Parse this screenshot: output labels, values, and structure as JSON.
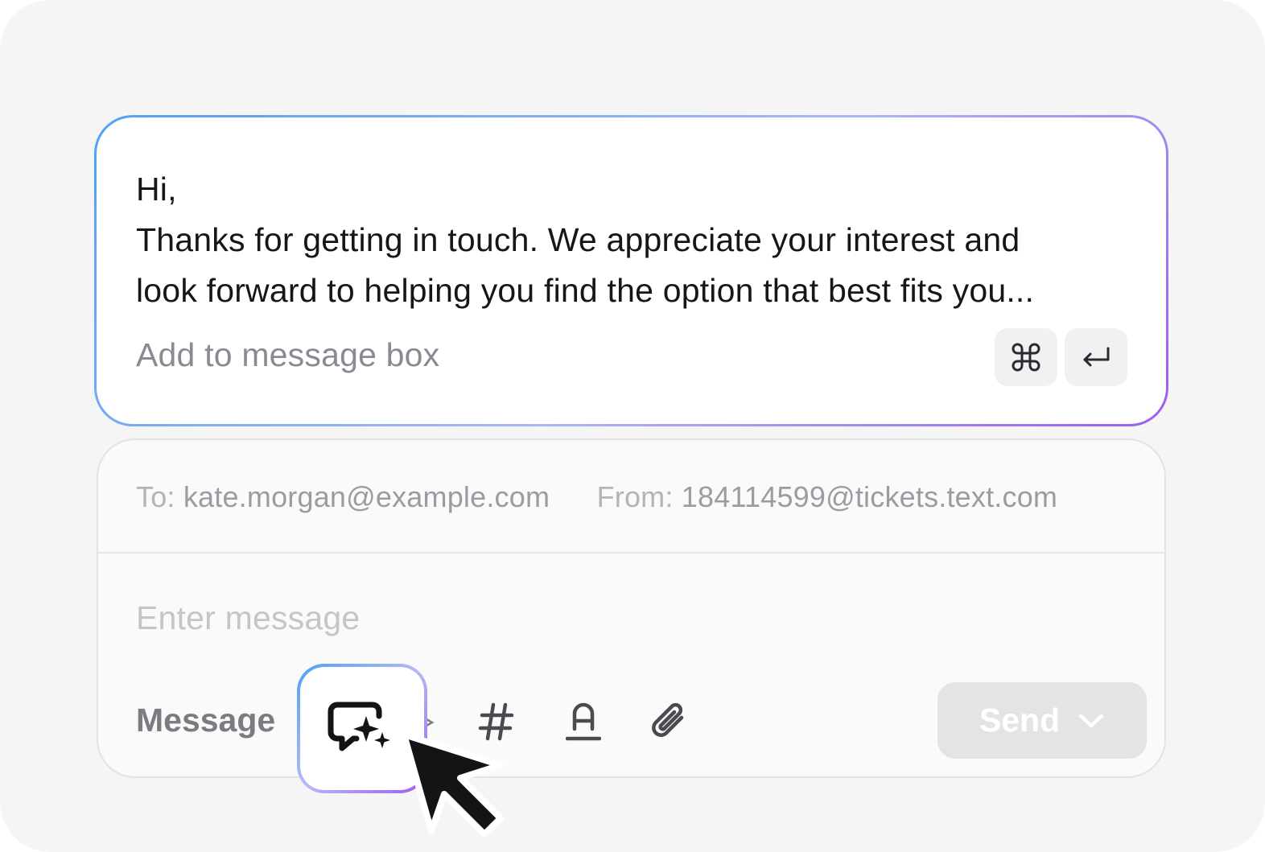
{
  "ai_suggestion": {
    "lines": [
      "Hi,",
      "Thanks for getting in touch. We appreciate your interest and",
      "look forward to helping you find the option that best fits you..."
    ],
    "add_hint": "Add to message box",
    "shortcut_keys": [
      "command-icon",
      "enter-icon"
    ]
  },
  "composer": {
    "to_label": "To:",
    "to_value": "kate.morgan@example.com",
    "from_label": "From:",
    "from_value": "184114599@tickets.text.com",
    "message_placeholder": "Enter message",
    "mode_label": "Message",
    "tools": [
      "ai-compose-icon",
      "hash-icon",
      "text-format-icon",
      "paperclip-icon"
    ],
    "send_label": "Send"
  },
  "colors": {
    "gradient_start": "#4fa2f4",
    "gradient_end": "#9d5cf0",
    "background": "#f5f5f6",
    "send_disabled": "#e4e4e6"
  }
}
